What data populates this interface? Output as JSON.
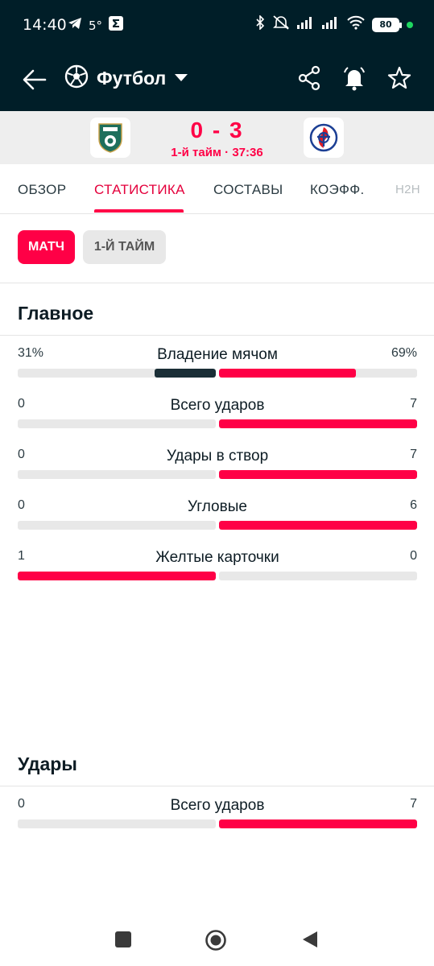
{
  "status_bar": {
    "time": "14:40",
    "temperature": "5°",
    "battery": "80",
    "icons_left": [
      "telegram-icon",
      "weather-icon",
      "sigma-app-icon"
    ],
    "icons_right": [
      "bluetooth-icon",
      "mute-icon",
      "signal-icon",
      "signal-icon",
      "wifi-icon",
      "battery-icon"
    ]
  },
  "header": {
    "sport_title": "Футбол",
    "icons": [
      "back-arrow-icon",
      "soccer-ball-icon",
      "chevron-down-icon",
      "share-icon",
      "alarm-bell-icon",
      "star-icon"
    ]
  },
  "match": {
    "score": "0 - 3",
    "period": "1-й тайм · 37:36"
  },
  "tabs": [
    {
      "label": "ОБЗОР"
    },
    {
      "label": "СТАТИСТИКА"
    },
    {
      "label": "СОСТАВЫ"
    },
    {
      "label": "КОЭФФ."
    },
    {
      "label": "H2H"
    }
  ],
  "pills": {
    "match": "МАТЧ",
    "first_half": "1-Й ТАЙМ"
  },
  "sections": {
    "main_title": "Главное",
    "shots_title": "Удары"
  },
  "stats_main": [
    {
      "label": "Владение мячом",
      "home": "31%",
      "away": "69%",
      "home_share": 0.31,
      "away_share": 0.69
    },
    {
      "label": "Всего ударов",
      "home": "0",
      "away": "7",
      "home_share": 0,
      "away_share": 1
    },
    {
      "label": "Удары в створ",
      "home": "0",
      "away": "7",
      "home_share": 0,
      "away_share": 1
    },
    {
      "label": "Угловые",
      "home": "0",
      "away": "6",
      "home_share": 0,
      "away_share": 1
    },
    {
      "label": "Желтые карточки",
      "home": "1",
      "away": "0",
      "home_share": 1,
      "away_share": 0
    }
  ],
  "stats_shots": [
    {
      "label": "Всего ударов",
      "home": "0",
      "away": "7",
      "home_share": 0,
      "away_share": 1
    }
  ],
  "colors": {
    "accent": "#ff0046",
    "header_bg": "#001e28",
    "home_possession": "#1a2e36",
    "track": "#e8e8e8"
  }
}
